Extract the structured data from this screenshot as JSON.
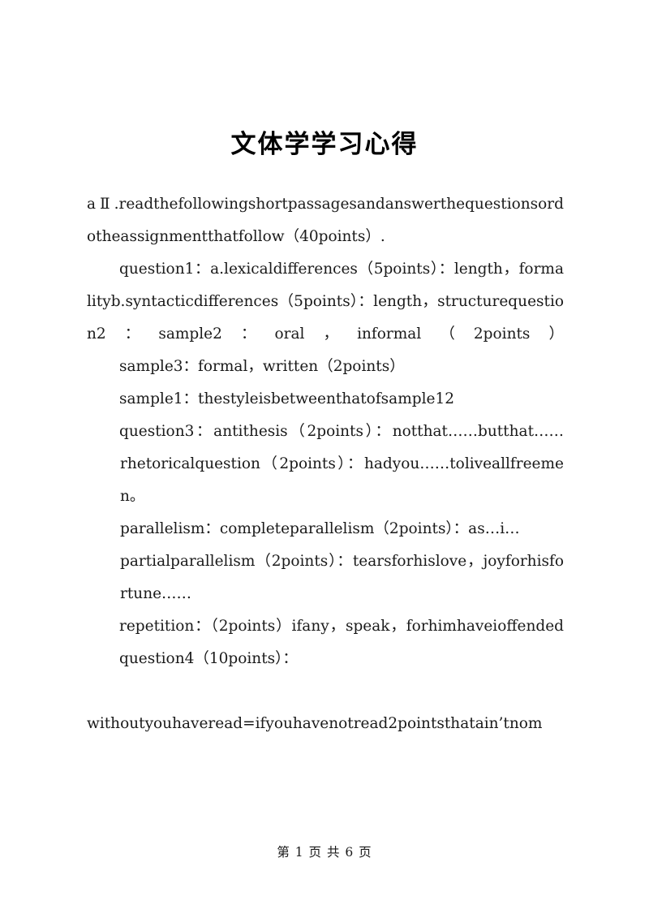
{
  "document": {
    "title": "文体学学习心得",
    "page_background": "#ffffff",
    "text_color": "#1a1a1a"
  },
  "content": {
    "paragraphs": [
      {
        "id": "p1",
        "style": "no-indent",
        "text": "aⅡ.readthefollowingshortpassagesandanswerthequestionsordotheassignmentthatfollow（40points）."
      },
      {
        "id": "p2",
        "style": "indent",
        "text": "question1：a.lexicaldifferences（5points）：length，formalityb.syntacticdifferences（5points）：length，structurequestion2：sample2：oral，informal（2points）"
      },
      {
        "id": "p3",
        "style": "indent",
        "text": "sample3：formal，written（2points）"
      },
      {
        "id": "p4",
        "style": "indent",
        "text": "sample1：thestyleisbetweenthatofsample12"
      },
      {
        "id": "p5",
        "style": "indent",
        "text": "question3：antithesis（2points）：notthat……butthat……"
      },
      {
        "id": "p6",
        "style": "block-indent",
        "text": "rhetoricalquestion（2points）：hadyou……toliveallfreemen。"
      },
      {
        "id": "p7",
        "style": "block-indent",
        "text": "parallelism：completeparallelism（2points）：as…i…"
      },
      {
        "id": "p8",
        "style": "block-indent",
        "text": "partialparallelism（2points）：tearsforhislove，joyforhisfortune……"
      },
      {
        "id": "p9",
        "style": "indent",
        "text": "repetition：（2points）ifany，speak，forhimhaveioffended"
      },
      {
        "id": "p10",
        "style": "indent",
        "text": "question4（10points）："
      },
      {
        "id": "p11",
        "style": "no-indent",
        "text": "withoutyouhaveread=ifyouhavenotread2pointsthatain’tnom"
      }
    ]
  },
  "footer": {
    "page_label": "第 1 页  共 6 页",
    "current_page": 1,
    "total_pages": 6
  }
}
